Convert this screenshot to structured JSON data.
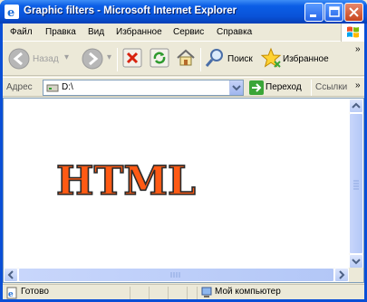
{
  "window": {
    "title": "Graphic filters - Microsoft Internet Explorer"
  },
  "menubar": {
    "items": [
      {
        "label": "Файл"
      },
      {
        "label": "Правка"
      },
      {
        "label": "Вид"
      },
      {
        "label": "Избранное"
      },
      {
        "label": "Сервис"
      },
      {
        "label": "Справка"
      }
    ]
  },
  "toolbar": {
    "back_label": "Назад",
    "search_label": "Поиск",
    "favorites_label": "Избранное"
  },
  "addressbar": {
    "label": "Адрес",
    "value": "D:\\",
    "go_label": "Переход",
    "links_label": "Ссылки"
  },
  "page": {
    "heading": "HTML"
  },
  "statusbar": {
    "status_text": "Готово",
    "zone_text": "Мой компьютер"
  },
  "colors": {
    "heading_fill": "#ff5a14",
    "heading_outline": "#2b2b2b",
    "title_bar": "#0b5ee6"
  }
}
